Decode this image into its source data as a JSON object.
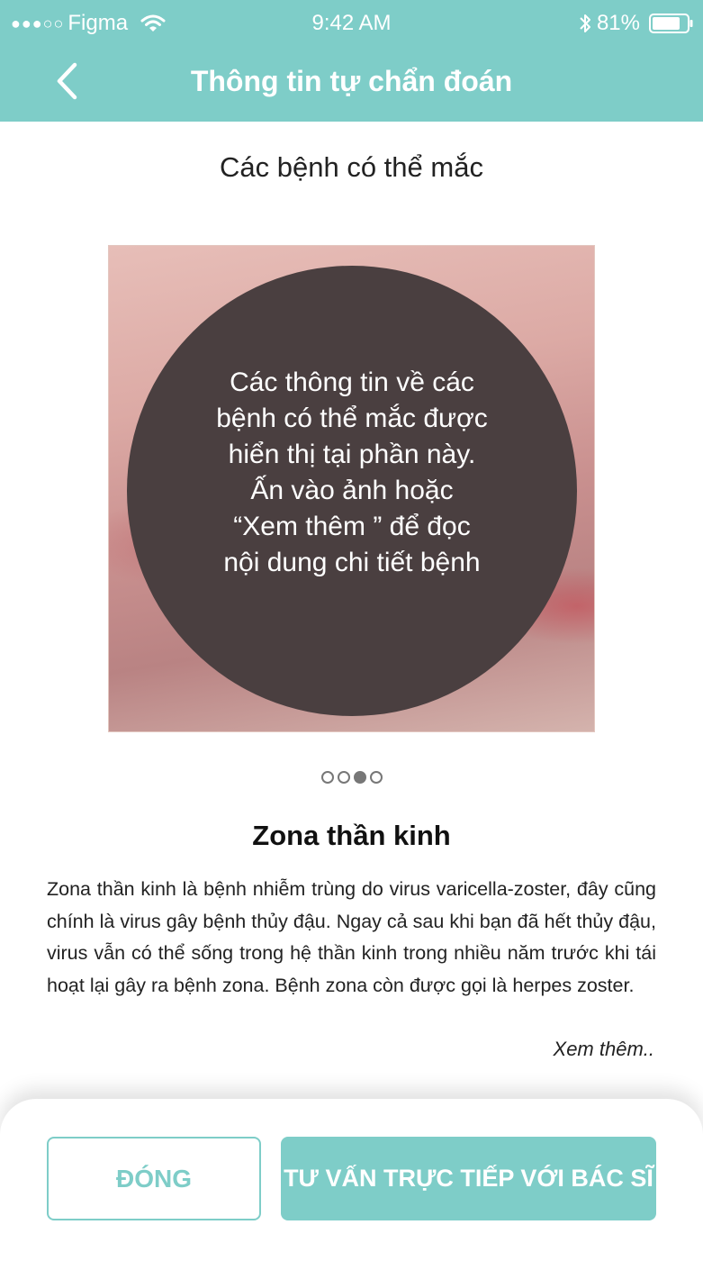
{
  "status_bar": {
    "signal": "●●●○○",
    "carrier": "Figma",
    "time": "9:42 AM",
    "battery_percent": "81%",
    "battery_level": 0.81
  },
  "nav": {
    "back_icon": "chevron-left-icon",
    "title": "Thông tin tự chẩn đoán"
  },
  "section_title": "Các bệnh có thể mắc",
  "image_overlay_text": "Các thông tin về các\nbệnh có thể mắc được\nhiển thị tại phần này.\nẤn vào ảnh hoặc\n“Xem thêm ” để đọc\nnội dung chi tiết bệnh",
  "pager": {
    "total": 4,
    "active_index": 2
  },
  "disease": {
    "name": "Zona thần kinh",
    "description": "Zona thần kinh là bệnh nhiễm trùng do virus varicella-zoster, đây cũng chính là virus gây bệnh thủy đậu. Ngay cả sau khi bạn đã hết thủy đậu, virus vẫn có thể sống trong hệ thần kinh trong nhiều năm trước khi tái hoạt lại gây ra bệnh zona. Bệnh zona còn được gọi là herpes zoster.",
    "read_more": "Xem thêm.."
  },
  "actions": {
    "close_label": "ĐÓNG",
    "consult_label": "TƯ VẤN TRỰC TIẾP VỚI BÁC SĨ"
  },
  "colors": {
    "accent": "#7ecdc8",
    "overlay": "#4a3f40"
  }
}
